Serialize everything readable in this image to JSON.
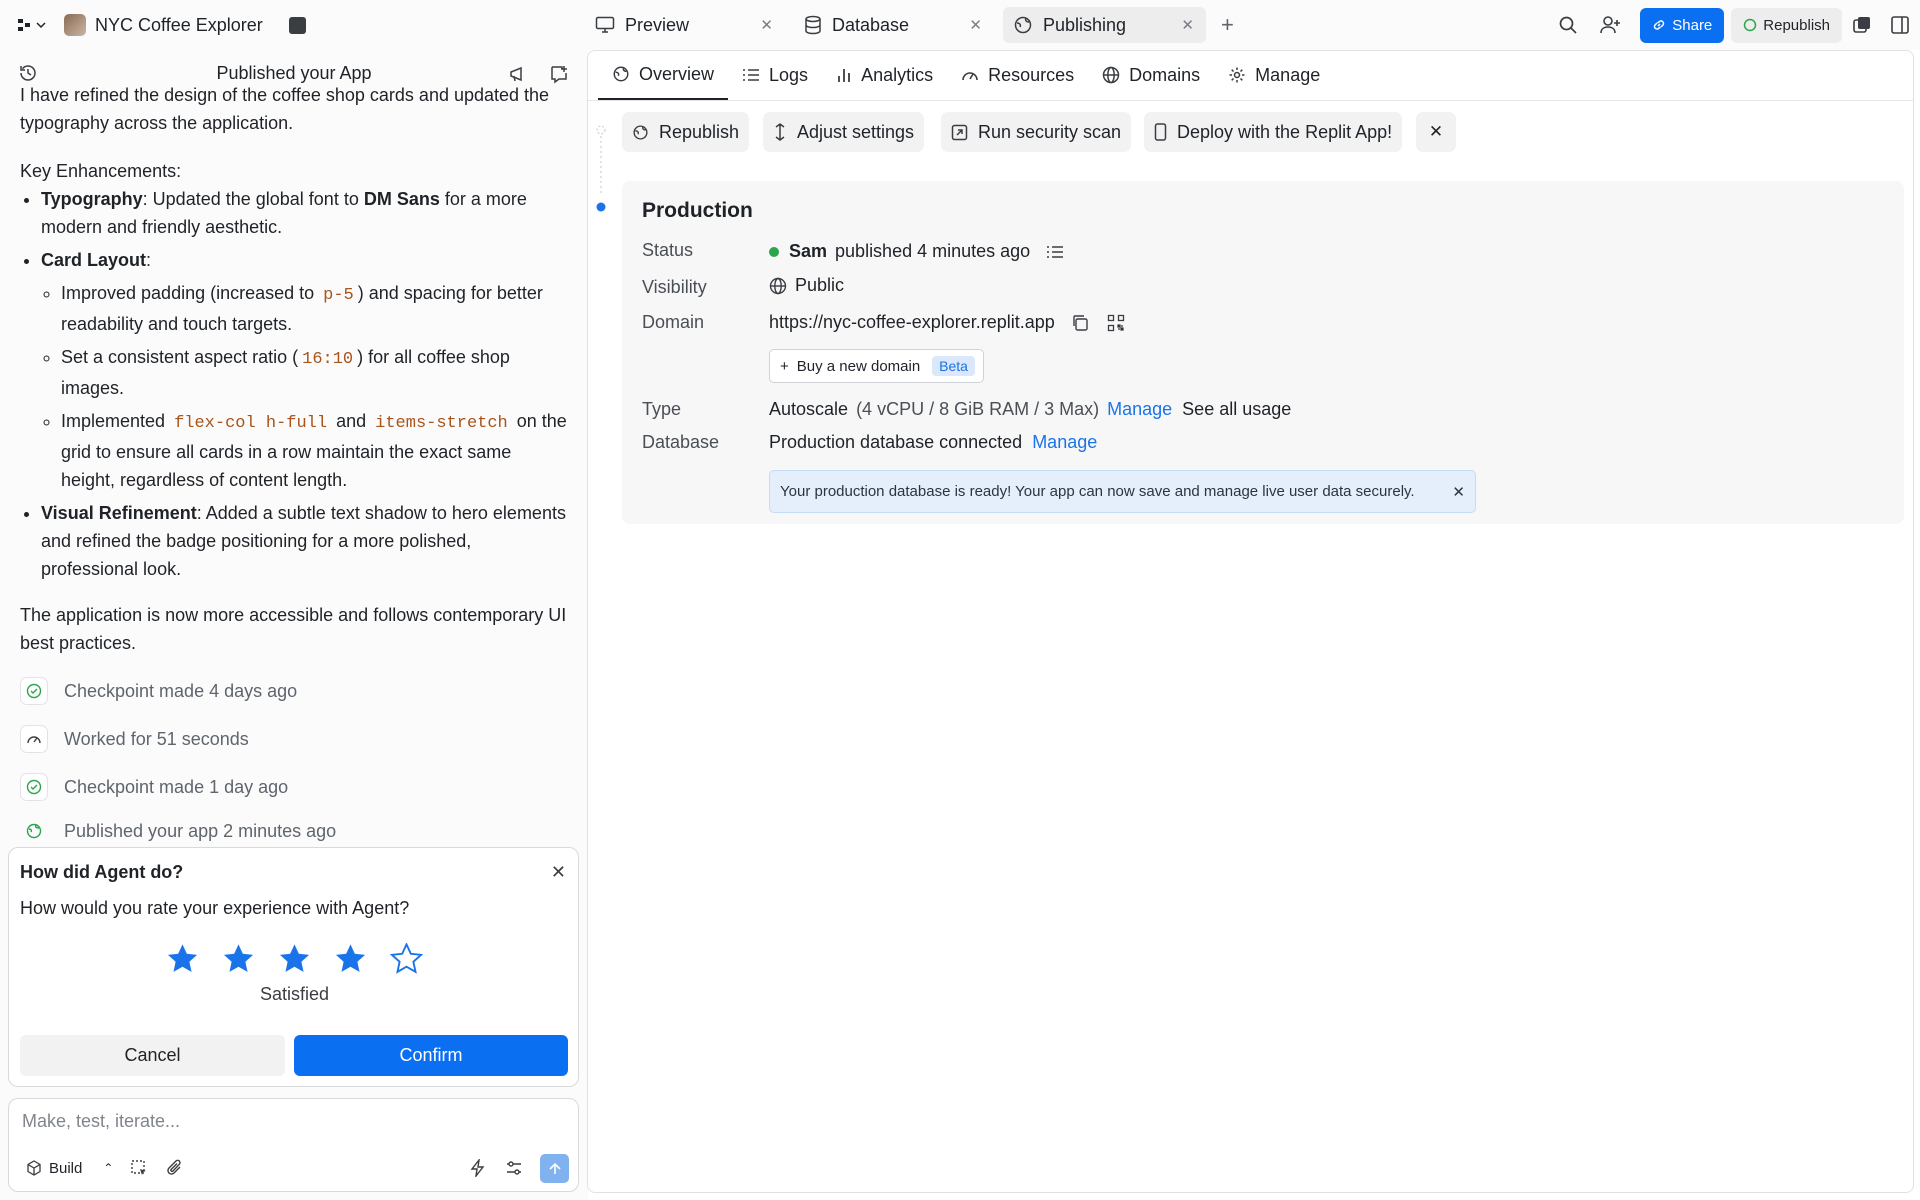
{
  "app": {
    "name": "NYC Coffee Explorer"
  },
  "tabs": [
    {
      "label": "Preview"
    },
    {
      "label": "Database"
    },
    {
      "label": "Publishing"
    }
  ],
  "header": {
    "share_label": "Share",
    "republish_label": "Republish"
  },
  "left": {
    "title": "Published your App",
    "intro": "I have refined the design of the coffee shop cards and updated the typography across the application.",
    "enhancements_heading": "Key Enhancements:",
    "b1_bold": "Typography",
    "b1_text1": ": Updated the global font to ",
    "b1_bold2": "DM Sans",
    "b1_text2": " for a more modern and friendly aesthetic.",
    "b2_bold": "Card Layout",
    "b2_text": ":",
    "s1_text1": "Improved padding (increased to ",
    "s1_code": "p-5",
    "s1_text2": ") and spacing for better readability and touch targets.",
    "s2_text1": "Set a consistent aspect ratio (",
    "s2_code": "16:10",
    "s2_text2": ") for all coffee shop images.",
    "s3_text1": "Implemented ",
    "s3_code1": "flex-col h-full",
    "s3_text2": " and ",
    "s3_code2": "items-stretch",
    "s3_text3": " on the grid to ensure all cards in a row maintain the exact same height, regardless of content length.",
    "b3_bold": "Visual Refinement",
    "b3_text": ": Added a subtle text shadow to hero elements and refined the badge positioning for a more polished, professional look.",
    "closing": "The application is now more accessible and follows contemporary UI best practices.",
    "events": [
      {
        "label": "Checkpoint made 4 days ago",
        "icon": "check-circle-icon"
      },
      {
        "label": "Worked for 51 seconds",
        "icon": "gauge-icon"
      },
      {
        "label": "Checkpoint made 1 day ago",
        "icon": "check-circle-icon"
      },
      {
        "label": "Published your app 2 minutes ago",
        "icon": "globe-icon"
      }
    ]
  },
  "rating": {
    "title": "How did Agent do?",
    "question": "How would you rate your experience with Agent?",
    "stars": 4,
    "max_stars": 5,
    "result": "Satisfied",
    "cancel": "Cancel",
    "confirm": "Confirm"
  },
  "composer": {
    "placeholder": "Make, test, iterate...",
    "mode": "Build"
  },
  "right": {
    "tabs": [
      "Overview",
      "Logs",
      "Analytics",
      "Resources",
      "Domains",
      "Manage"
    ],
    "actions": [
      "Republish",
      "Adjust settings",
      "Run security scan",
      "Deploy with the Replit App!"
    ],
    "section": "Production",
    "status_label": "Status",
    "status_user": "Sam",
    "status_text": "published 4 minutes ago",
    "visibility_label": "Visibility",
    "visibility_value": "Public",
    "domain_label": "Domain",
    "domain_value": "https://nyc-coffee-explorer.replit.app",
    "buy_domain": "Buy a new domain",
    "beta": "Beta",
    "type_label": "Type",
    "type_value": "Autoscale",
    "type_detail": "(4 vCPU / 8 GiB RAM / 3 Max)",
    "manage": "Manage",
    "see_usage": "See all usage",
    "db_label": "Database",
    "db_value": "Production database connected",
    "notice": "Your production database is ready! Your app can now save and manage live user data securely."
  },
  "colors": {
    "accent": "#0b6ff2",
    "status_green": "#2da44e",
    "star": "#1a73e8",
    "notice_bg": "#e5effb"
  }
}
